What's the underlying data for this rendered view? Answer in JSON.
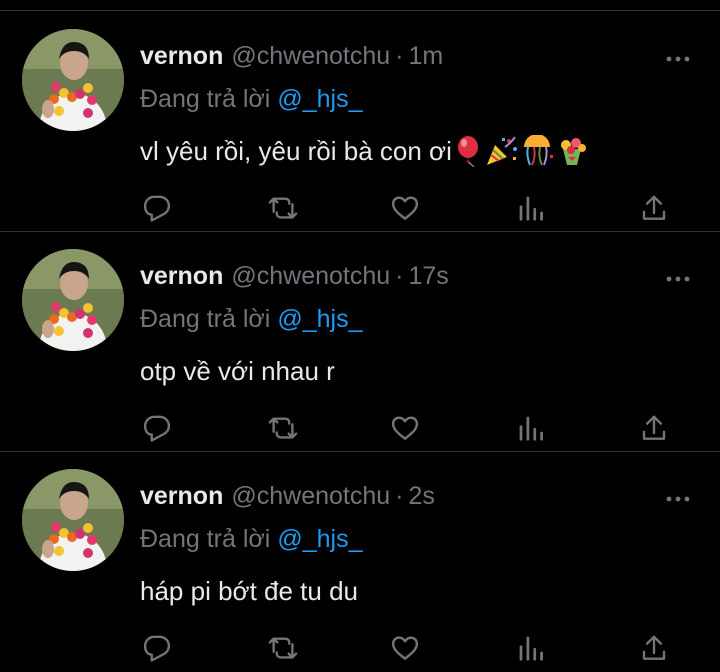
{
  "colors": {
    "background": "#000000",
    "primary_text": "#e7e9ea",
    "secondary_text": "#71767b",
    "link": "#1d9bf0",
    "divider": "#2f3336"
  },
  "tweets": [
    {
      "display_name": "vernon",
      "handle": "@chwenotchu",
      "separator": "·",
      "time": "1m",
      "reply_prefix": "Đang trả lời",
      "reply_to": "@_hjs_",
      "text": "vl yêu rồi, yêu rồi bà con ơi",
      "emojis": [
        "balloon",
        "party-popper",
        "confetti-ball",
        "bouquet"
      ]
    },
    {
      "display_name": "vernon",
      "handle": "@chwenotchu",
      "separator": "·",
      "time": "17s",
      "reply_prefix": "Đang trả lời",
      "reply_to": "@_hjs_",
      "text": "otp về với nhau r",
      "emojis": []
    },
    {
      "display_name": "vernon",
      "handle": "@chwenotchu",
      "separator": "·",
      "time": "2s",
      "reply_prefix": "Đang trả lời",
      "reply_to": "@_hjs_",
      "text": "háp pi bớt đe tu du",
      "emojis": []
    }
  ],
  "action_icons": [
    "reply-icon",
    "retweet-icon",
    "like-icon",
    "analytics-icon",
    "share-icon"
  ]
}
